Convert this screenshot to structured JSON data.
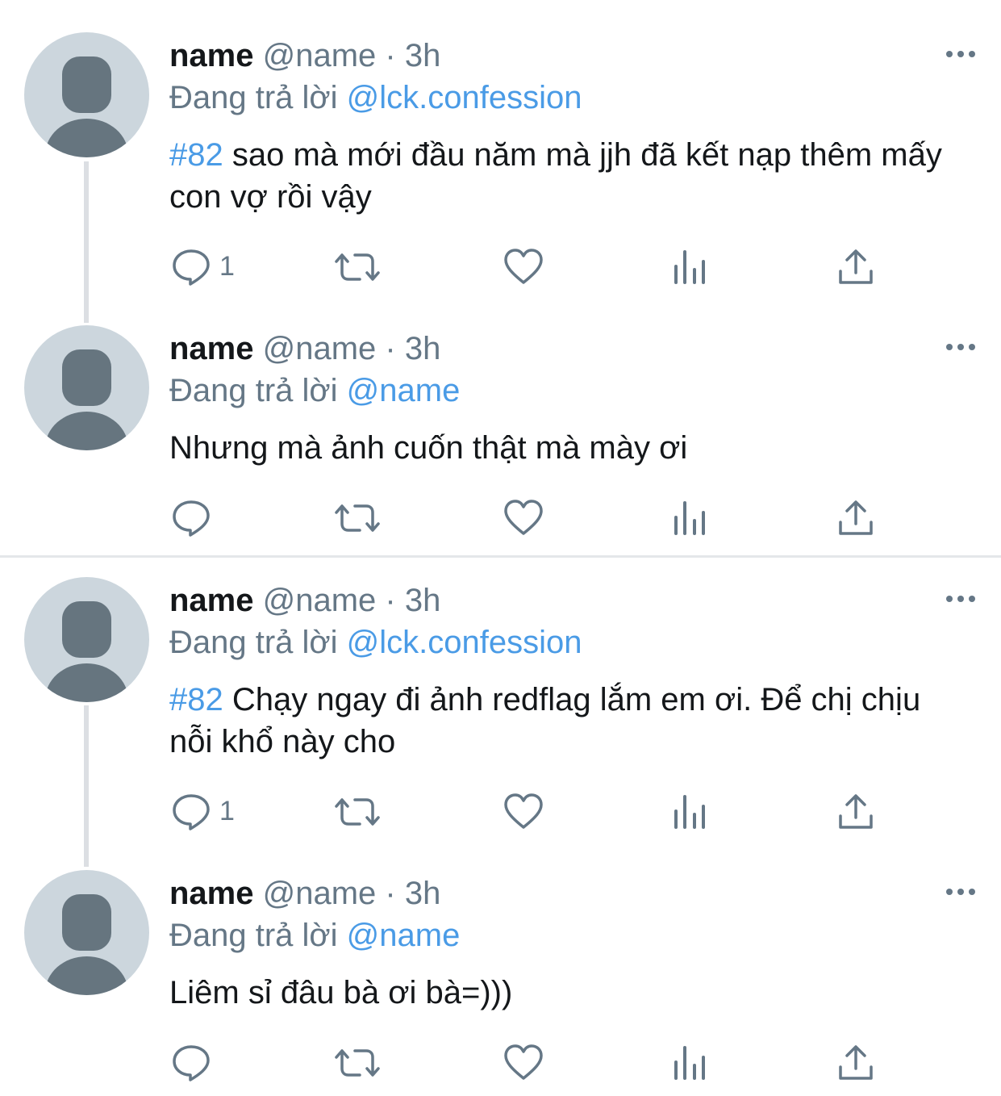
{
  "tweets": [
    {
      "name": "name",
      "handle": "@name",
      "dot": "·",
      "time": "3h",
      "reply_prefix": "Đang trả lời",
      "reply_to": "@lck.confession",
      "hashtag": "#82",
      "text": " sao mà mới đầu năm mà jjh đã kết nạp thêm mấy con vợ rồi vậy",
      "reply_count": "1"
    },
    {
      "name": "name",
      "handle": "@name",
      "dot": "·",
      "time": "3h",
      "reply_prefix": "Đang trả lời",
      "reply_to": "@name",
      "hashtag": "",
      "text": "Nhưng mà ảnh cuốn thật mà mày ơi",
      "reply_count": ""
    },
    {
      "name": "name",
      "handle": "@name",
      "dot": "·",
      "time": "3h",
      "reply_prefix": "Đang trả lời",
      "reply_to": "@lck.confession",
      "hashtag": "#82",
      "text": " Chạy ngay đi ảnh redflag lắm em ơi. Để chị chịu nỗi khổ này cho",
      "reply_count": "1"
    },
    {
      "name": "name",
      "handle": "@name",
      "dot": "·",
      "time": "3h",
      "reply_prefix": "Đang trả lời",
      "reply_to": "@name",
      "hashtag": "",
      "text": "Liêm sỉ đâu bà ơi bà=)))",
      "reply_count": ""
    }
  ],
  "icons": {
    "reply": "reply-icon",
    "retweet": "retweet-icon",
    "like": "heart-icon",
    "analytics": "analytics-icon",
    "share": "share-icon",
    "more": "more-icon"
  },
  "colors": {
    "text": "#14171a",
    "secondary": "#657786",
    "link": "#4a9be6",
    "avatar_bg": "#ccd6dd",
    "avatar_fg": "#66757f"
  }
}
